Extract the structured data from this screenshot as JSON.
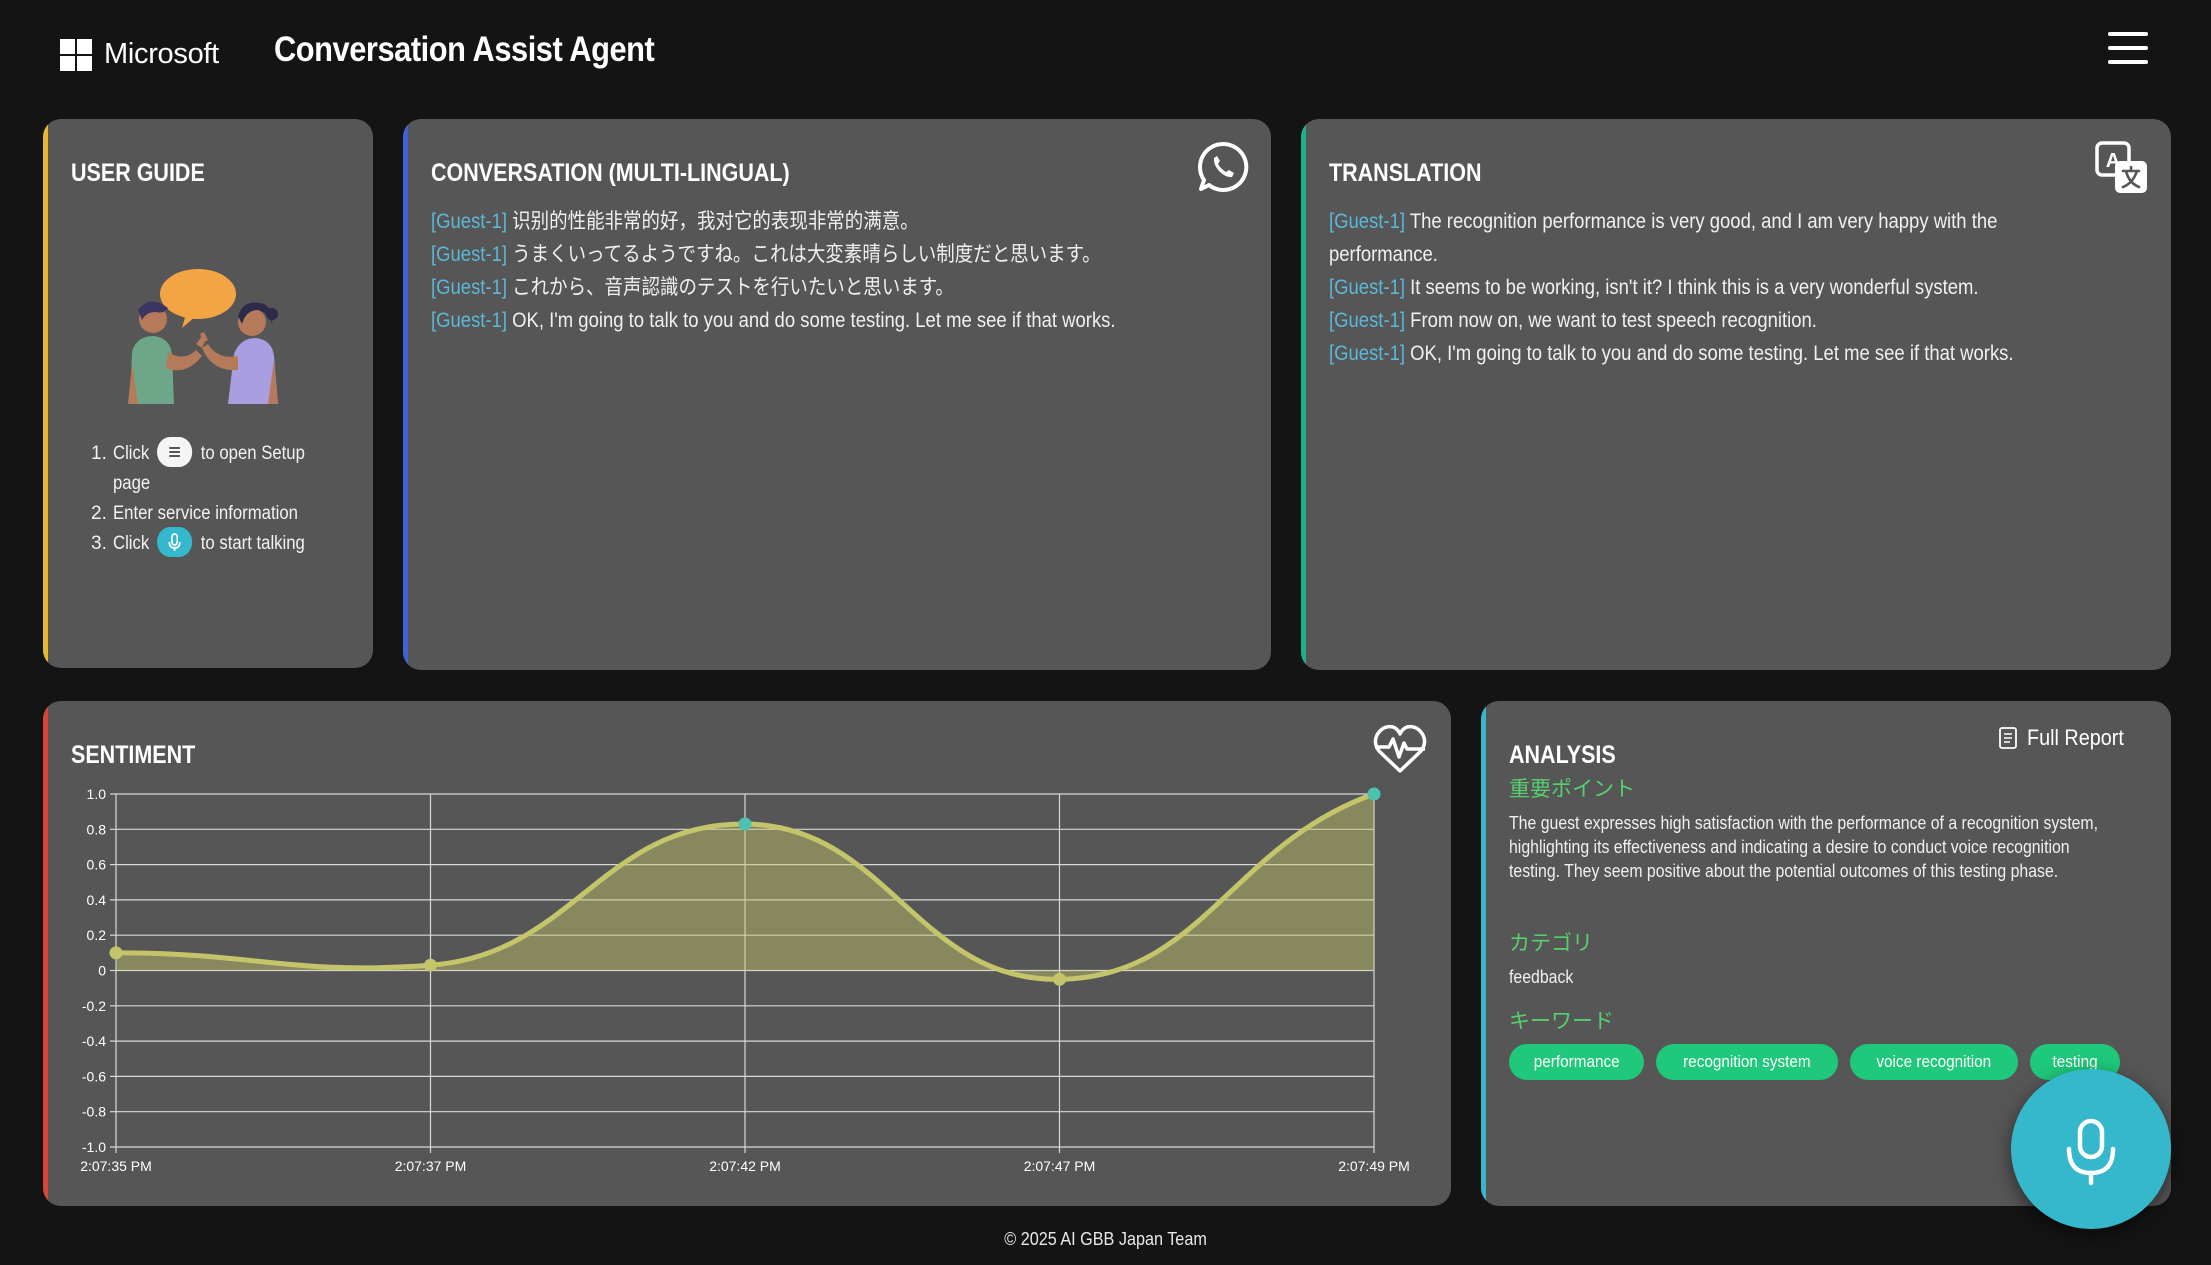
{
  "header": {
    "brand": "Microsoft",
    "title": "Conversation Assist Agent",
    "menu_icon": "hamburger-menu-icon"
  },
  "guide": {
    "title": "USER GUIDE",
    "steps": [
      {
        "num": "1.",
        "before": "Click",
        "icon": "menu-icon",
        "after": "to open Setup page"
      },
      {
        "num": "2.",
        "before": "Enter service information",
        "icon": "",
        "after": ""
      },
      {
        "num": "3.",
        "before": "Click",
        "icon": "mic-icon",
        "after": "to start talking"
      }
    ]
  },
  "conversation": {
    "title": "CONVERSATION (MULTI-LINGUAL)",
    "icon": "whatsapp-icon",
    "lines": [
      {
        "speaker": "[Guest-1]",
        "text": "识别的性能非常的好，我对它的表现非常的满意。"
      },
      {
        "speaker": "[Guest-1]",
        "text": "うまくいってるようですね。これは大変素晴らしい制度だと思います。"
      },
      {
        "speaker": "[Guest-1]",
        "text": "これから、音声認識のテストを行いたいと思います。"
      },
      {
        "speaker": "[Guest-1]",
        "text": "OK, I'm going to talk to you and do some testing. Let me see if that works."
      }
    ]
  },
  "translation": {
    "title": "TRANSLATION",
    "icon": "translate-icon",
    "lines": [
      {
        "speaker": "[Guest-1]",
        "text": "The recognition performance is very good, and I am very happy with the performance."
      },
      {
        "speaker": "[Guest-1]",
        "text": "It seems to be working, isn't it? I think this is a very wonderful system."
      },
      {
        "speaker": "[Guest-1]",
        "text": "From now on, we want to test speech recognition."
      },
      {
        "speaker": "[Guest-1]",
        "text": "OK, I'm going to talk to you and do some testing. Let me see if that works."
      }
    ]
  },
  "sentiment": {
    "title": "SENTIMENT",
    "icon": "heartbeat-icon"
  },
  "chart_data": {
    "type": "line",
    "title": "",
    "xlabel": "",
    "ylabel": "",
    "categories": [
      "2:07:35 PM",
      "2:07:37 PM",
      "2:07:42 PM",
      "2:07:47 PM",
      "2:07:49 PM"
    ],
    "series": [
      {
        "values": [
          0.1,
          0.03,
          0.83,
          -0.05,
          1.0
        ]
      }
    ],
    "yticks": [
      "1.0",
      "0.8",
      "0.6",
      "0.4",
      "0.2",
      "0",
      "-0.2",
      "-0.4",
      "-0.6",
      "-0.8",
      "-1.0"
    ],
    "ylim": [
      -1.0,
      1.0
    ],
    "grid": true,
    "fill": true,
    "colors": {
      "high": "#4fc1b0",
      "low": "#c4c56a"
    }
  },
  "analysis": {
    "title": "ANALYSIS",
    "full_report": "Full Report",
    "full_report_icon": "report-icon",
    "summary_heading": "重要ポイント",
    "summary": "The guest expresses high satisfaction with the performance of a recognition system, highlighting its effectiveness and indicating a desire to conduct voice recognition testing. They seem positive about the potential outcomes of this testing phase.",
    "category_heading": "カテゴリ",
    "category": "feedback",
    "keywords_heading": "キーワード",
    "keywords": [
      "performance",
      "recognition system",
      "voice recognition",
      "testing"
    ]
  },
  "mic_button": {
    "icon": "microphone-icon"
  },
  "footer": "© 2025 AI GBB Japan Team",
  "colors": {
    "guide_accent": "#e6b92c",
    "conversation_accent": "#3f63d6",
    "translation_accent": "#1db08a",
    "sentiment_accent": "#d9453a",
    "analysis_accent": "#35b7cc",
    "speaker": "#5bb8d6",
    "heading_green": "#56d06e",
    "tag": "#1fc87a"
  }
}
